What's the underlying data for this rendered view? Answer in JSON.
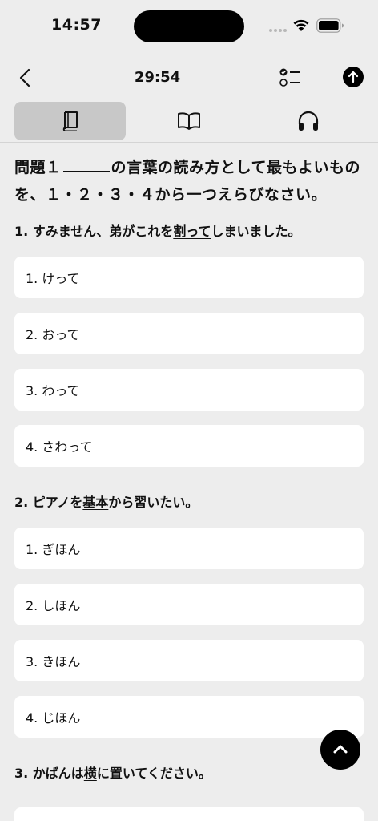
{
  "status_bar": {
    "time": "14:57"
  },
  "nav": {
    "timer": "29:54"
  },
  "tabs": [
    {
      "icon": "book-icon",
      "active": true
    },
    {
      "icon": "open-book-icon",
      "active": false
    },
    {
      "icon": "headphones-icon",
      "active": false
    }
  ],
  "instruction": {
    "prefix": "問題１",
    "suffix": "の言葉の読み方として最もよいものを、１・２・３・４から一つえらびなさい。"
  },
  "questions": [
    {
      "before": "1. すみません、弟がこれを",
      "underlined": "割って",
      "after": "しまいました。",
      "options": [
        "1. けって",
        "2. おって",
        "3. わって",
        "4. さわって"
      ]
    },
    {
      "before": "2. ピアノを",
      "underlined": "基本",
      "after": "から習いたい。",
      "options": [
        "1. ぎほん",
        "2. しほん",
        "3. きほん",
        "4. じほん"
      ]
    },
    {
      "before": "3. かばんは",
      "underlined": "横",
      "after": "に置いてください。",
      "options": []
    }
  ],
  "colors": {
    "background": "#ededed",
    "card": "#ffffff",
    "active_tab": "#c8c8c8",
    "text": "#111111"
  }
}
